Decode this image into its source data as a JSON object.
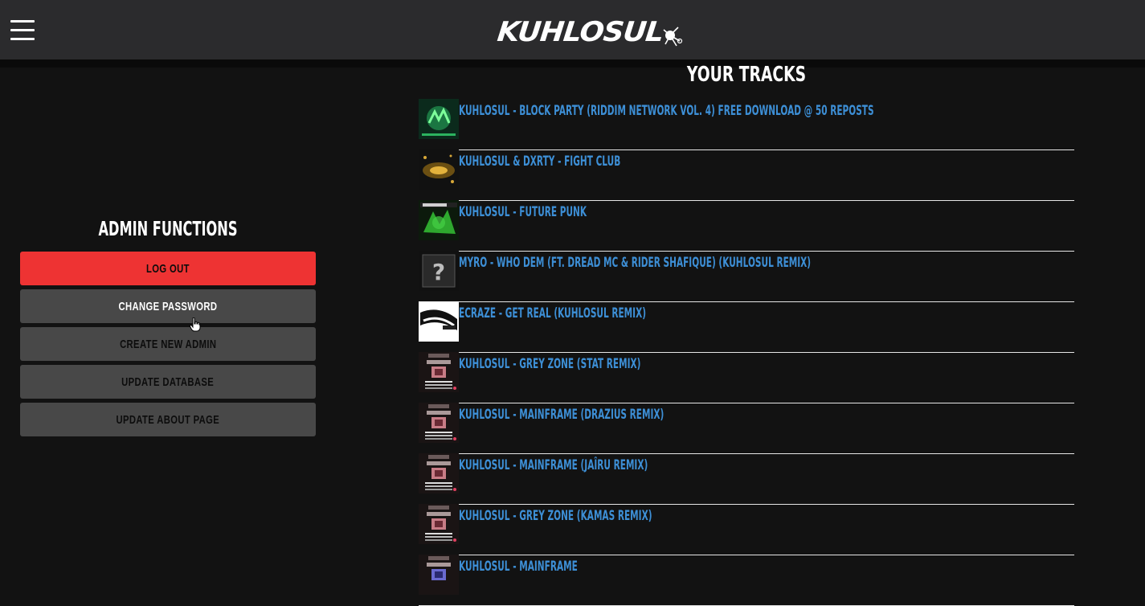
{
  "header": {
    "logo_text": "KUHLOSUL",
    "menu_icon": "hamburger-menu-icon"
  },
  "admin": {
    "title": "ADMIN FUNCTIONS",
    "buttons": [
      {
        "label": "LOG OUT"
      },
      {
        "label": "CHANGE PASSWORD"
      },
      {
        "label": "CREATE NEW ADMIN"
      },
      {
        "label": "UPDATE DATABASE"
      },
      {
        "label": "UPDATE ABOUT PAGE"
      }
    ]
  },
  "tracks": {
    "title": "YOUR TRACKS",
    "items": [
      {
        "title": "KUHLOSUL - BLOCK PARTY (RIDDIM NETWORK VOL. 4) FREE DOWNLOAD @ 50 REPOSTS",
        "thumb": "green-network-art"
      },
      {
        "title": "KUHLOSUL & DXRTY - FIGHT CLUB",
        "thumb": "gold-fight-club-art"
      },
      {
        "title": "KUHLOSUL - FUTURE PUNK",
        "thumb": "green-future-punk-art"
      },
      {
        "title": "MYRO - WHO DEM (FT. DREAD MC & RIDER SHAFIQUE) (KUHLOSUL REMIX)",
        "thumb": "question-mark-art"
      },
      {
        "title": "ECRAZE - GET REAL (KUHLOSUL REMIX)",
        "thumb": "get-real-art"
      },
      {
        "title": "KUHLOSUL - GREY ZONE (STAT REMIX)",
        "thumb": "grey-zone-art"
      },
      {
        "title": "KUHLOSUL - MAINFRAME (DRAZIUS REMIX)",
        "thumb": "grey-zone-art"
      },
      {
        "title": "KUHLOSUL - MAINFRAME (JAÎRU REMIX)",
        "thumb": "grey-zone-art"
      },
      {
        "title": "KUHLOSUL - GREY ZONE (KAMAS REMIX)",
        "thumb": "grey-zone-art"
      },
      {
        "title": "KUHLOSUL - MAINFRAME",
        "thumb": "mainframe-art"
      }
    ]
  },
  "colors": {
    "background": "#121212",
    "header": "#2b2b2d",
    "logout": "#ee3333",
    "button": "#484848",
    "link": "#3d8fd6"
  }
}
